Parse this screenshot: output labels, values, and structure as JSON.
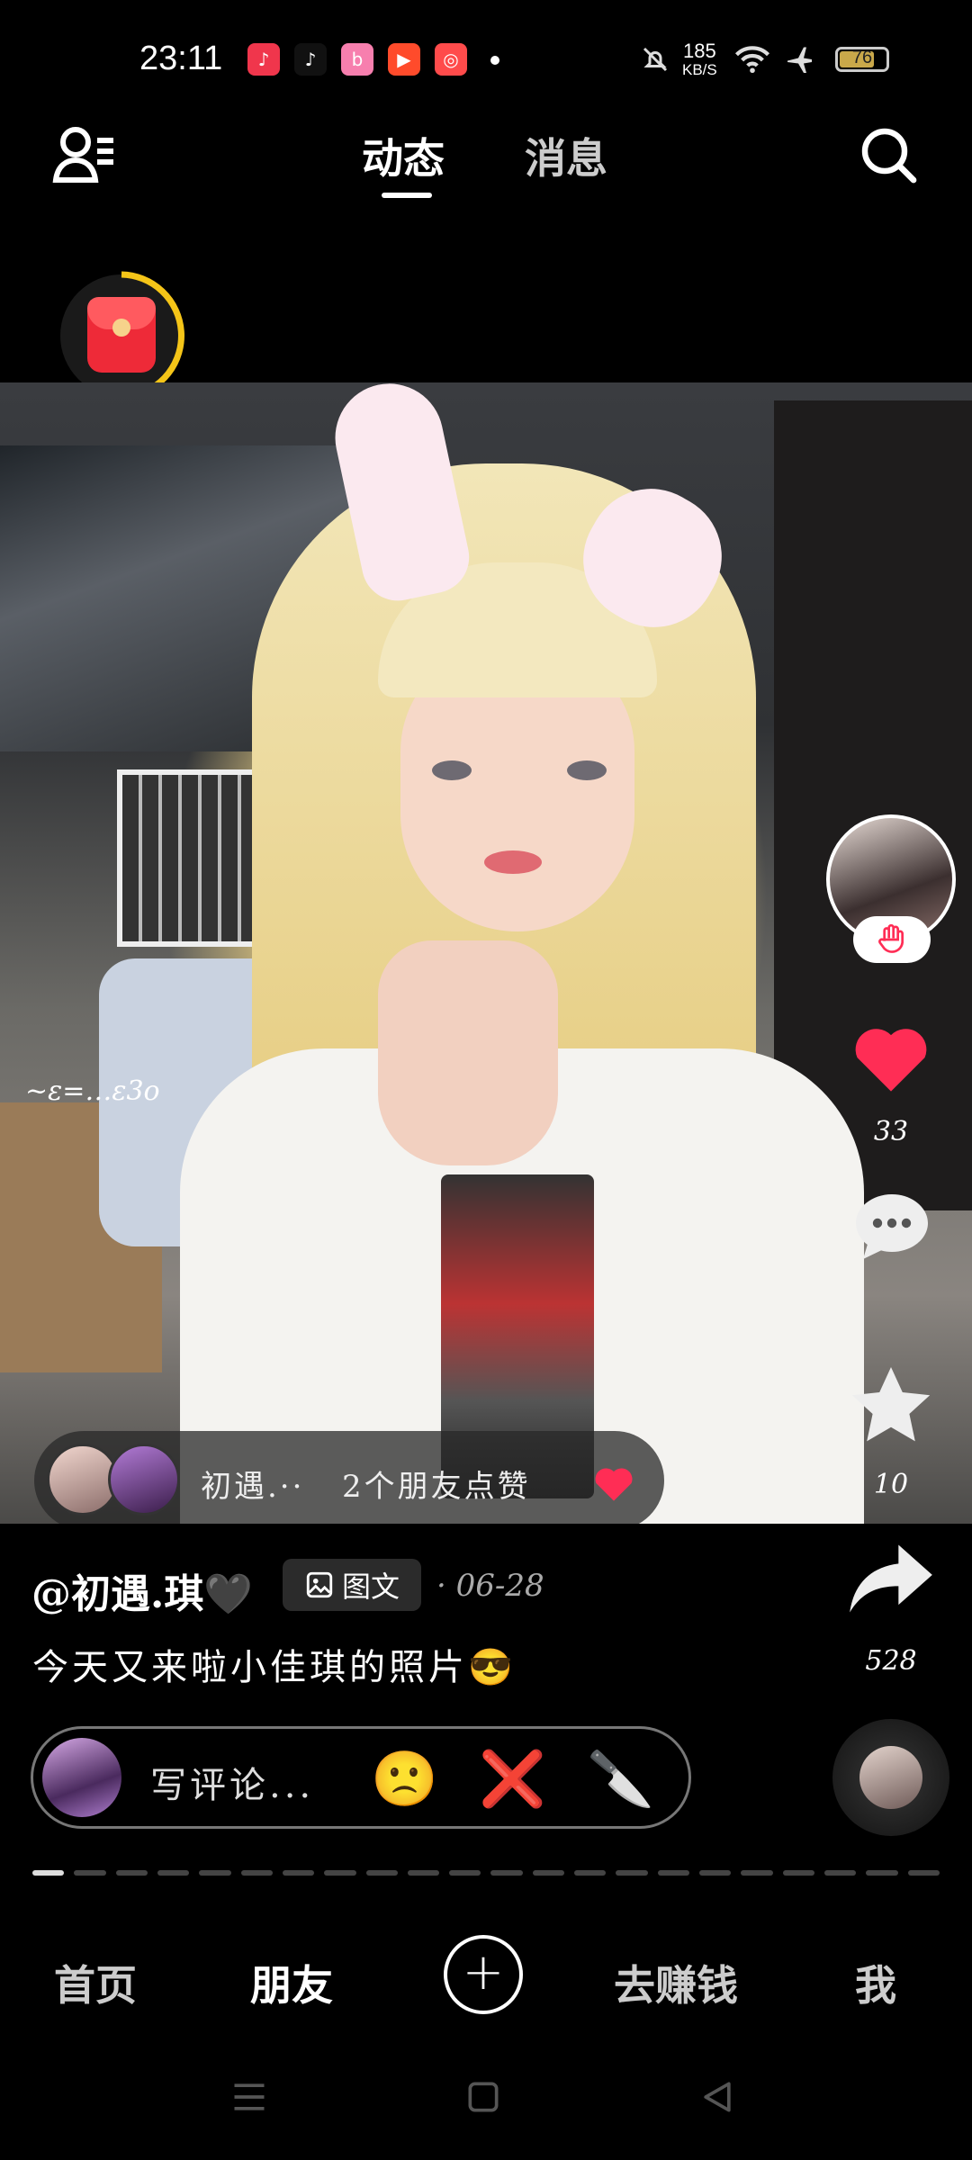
{
  "status_bar": {
    "time": "23:11",
    "apps": [
      {
        "name": "music-app-icon",
        "color": "#f0364c",
        "glyph": "♪"
      },
      {
        "name": "tiktok-app-icon",
        "color": "#111111",
        "glyph": "♪"
      },
      {
        "name": "bilibili-app-icon",
        "color": "#f77fae",
        "glyph": "b"
      },
      {
        "name": "video-app-icon",
        "color": "#ff4b2b",
        "glyph": "▶"
      },
      {
        "name": "camera-app-icon",
        "color": "#ff4b4b",
        "glyph": "◎"
      }
    ],
    "net_speed_value": "185",
    "net_speed_unit": "KB/S",
    "battery": 76
  },
  "top_nav": {
    "tabs": [
      "动态",
      "消息"
    ],
    "active_tab": 0
  },
  "photo": {
    "overlay_text": "~ε=…ε3o"
  },
  "friends_liked": {
    "name": "初遇.··",
    "text": "2个朋友点赞"
  },
  "right_rail": {
    "like_count": "33",
    "star_count": "10",
    "share_count": "528",
    "accent_color": "#ff2d55"
  },
  "post": {
    "author": "@初遇.琪🖤",
    "type_label": "图文",
    "date": "· 06-28",
    "caption": "今天又来啦小佳琪的照片😎"
  },
  "comment_bar": {
    "placeholder": "写评论...",
    "emojis": [
      "🙁",
      "❌",
      "🔪"
    ]
  },
  "progress": {
    "segments": 22,
    "active_index": 0
  },
  "bottom_nav": {
    "home": "首页",
    "friends": "朋友",
    "plus": "+",
    "earn": "去赚钱",
    "me": "我"
  }
}
